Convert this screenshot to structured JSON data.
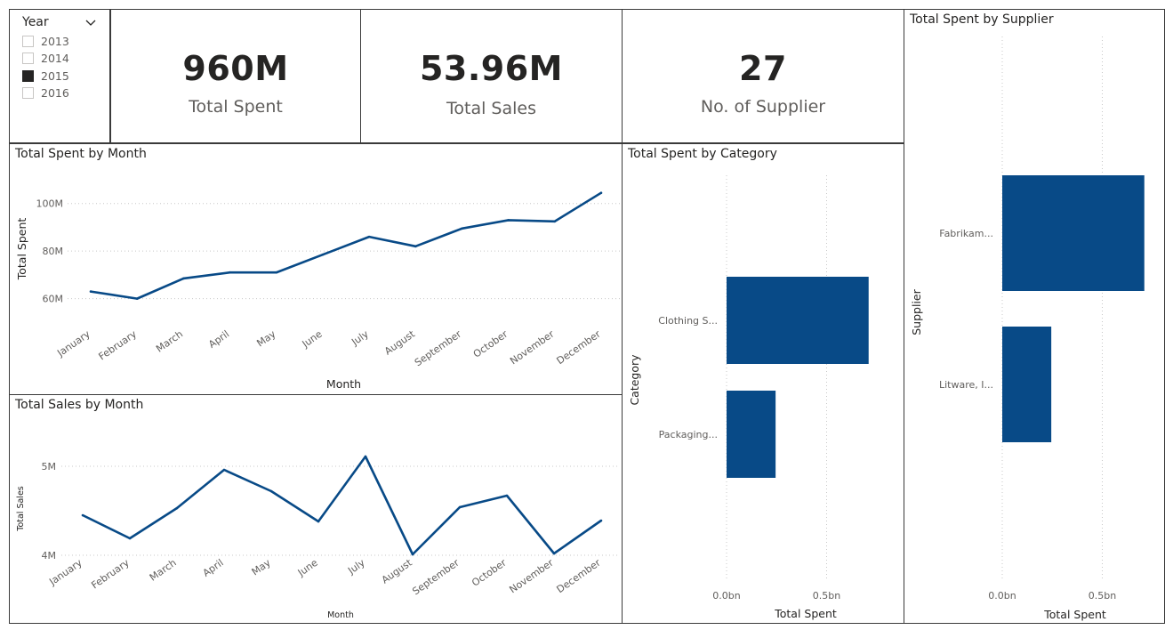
{
  "slicer": {
    "title": "Year",
    "options": [
      {
        "label": "2013",
        "checked": false
      },
      {
        "label": "2014",
        "checked": false
      },
      {
        "label": "2015",
        "checked": true
      },
      {
        "label": "2016",
        "checked": false
      }
    ]
  },
  "kpis": {
    "total_spent": {
      "value": "960M",
      "label": "Total Spent"
    },
    "total_sales": {
      "value": "53.96M",
      "label": "Total Sales"
    },
    "suppliers": {
      "value": "27",
      "label": "No. of Supplier"
    }
  },
  "colors": {
    "series": "#084a87",
    "grid": "#c8c8c8"
  },
  "chart_data": [
    {
      "id": "spent_month",
      "type": "line",
      "title": "Total Spent by Month",
      "xlabel": "Month",
      "ylabel": "Total Spent",
      "categories": [
        "January",
        "February",
        "March",
        "April",
        "May",
        "June",
        "July",
        "August",
        "September",
        "October",
        "November",
        "December"
      ],
      "values": [
        63,
        60,
        68.5,
        71,
        71,
        78.5,
        86,
        82,
        89.5,
        93,
        92.5,
        104.5
      ],
      "ylim": [
        52,
        110
      ],
      "yticks": [
        60,
        80,
        100
      ],
      "ytick_labels": [
        "60M",
        "80M",
        "100M"
      ]
    },
    {
      "id": "sales_month",
      "type": "line",
      "title": "Total Sales by Month",
      "xlabel": "Month",
      "ylabel": "Total Sales",
      "categories": [
        "January",
        "February",
        "March",
        "April",
        "May",
        "June",
        "July",
        "August",
        "September",
        "October",
        "November",
        "December"
      ],
      "values": [
        4.45,
        4.19,
        4.53,
        4.96,
        4.72,
        4.38,
        5.11,
        4.01,
        4.54,
        4.67,
        4.02,
        4.39
      ],
      "ylim": [
        3.8,
        5.25
      ],
      "yticks": [
        4,
        5
      ],
      "ytick_labels": [
        "4M",
        "5M"
      ]
    },
    {
      "id": "spent_category",
      "type": "bar",
      "orientation": "horizontal",
      "title": "Total Spent by Category",
      "xlabel": "Total Spent",
      "ylabel": "Category",
      "categories": [
        "Clothing S...",
        "Packaging..."
      ],
      "values": [
        0.71,
        0.245
      ],
      "xlim": [
        0,
        0.8
      ],
      "xticks": [
        0,
        0.5
      ],
      "xtick_labels": [
        "0.0bn",
        "0.5bn"
      ]
    },
    {
      "id": "spent_supplier",
      "type": "bar",
      "orientation": "horizontal",
      "title": "Total Spent by Supplier",
      "xlabel": "Total Spent",
      "ylabel": "Supplier",
      "categories": [
        "Fabrikam...",
        "Litware, I..."
      ],
      "values": [
        0.71,
        0.245
      ],
      "xlim": [
        0,
        0.8
      ],
      "xticks": [
        0,
        0.5
      ],
      "xtick_labels": [
        "0.0bn",
        "0.5bn"
      ]
    }
  ]
}
